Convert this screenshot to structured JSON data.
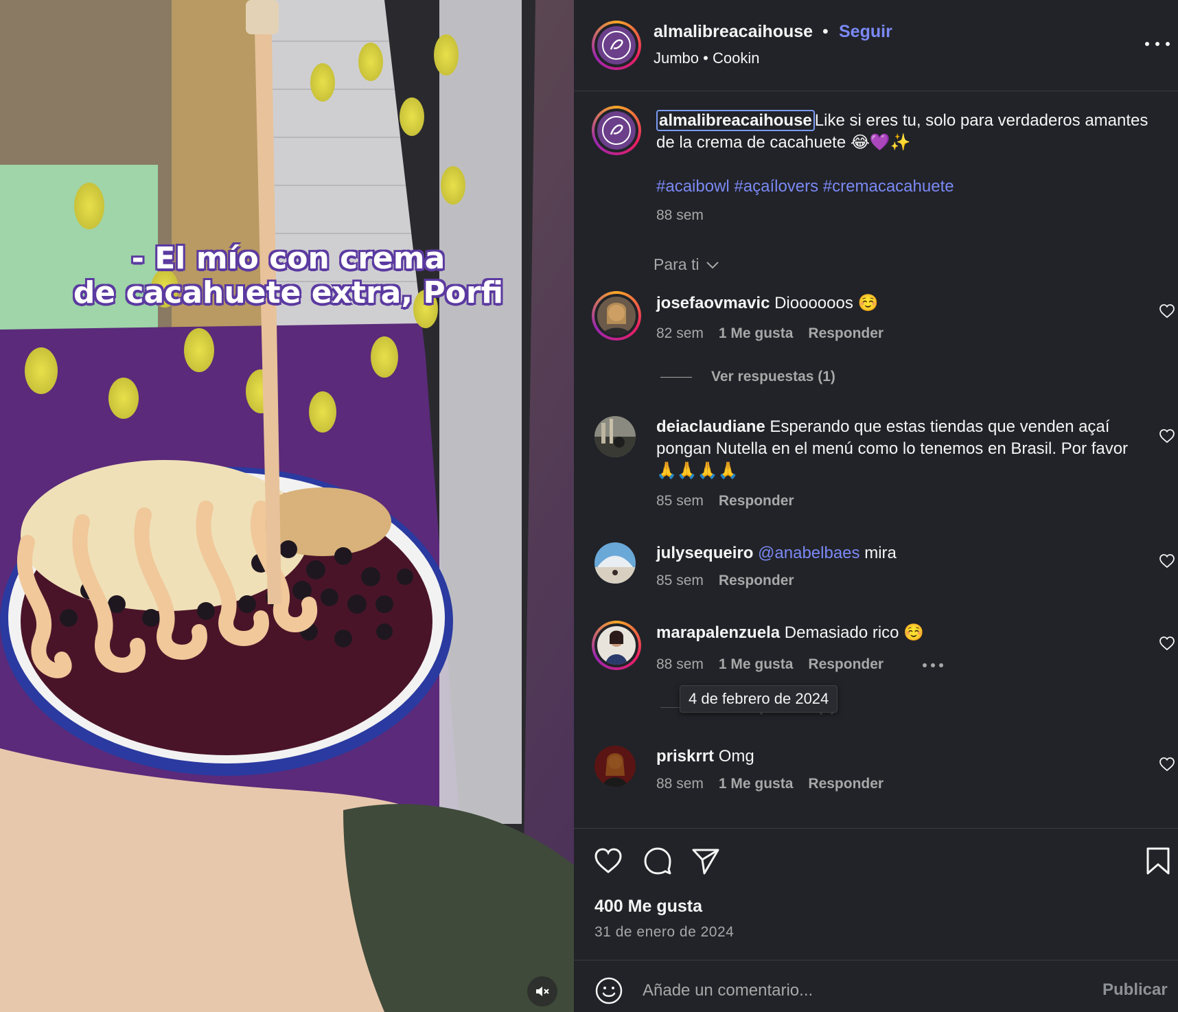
{
  "media": {
    "overlay_line1": "- El mío con crema",
    "overlay_line2": "de cacahuete extra, Porfi",
    "mute_icon": "speaker-muted-icon"
  },
  "header": {
    "username": "almalibreacaihouse",
    "separator": "•",
    "follow_label": "Seguir",
    "subtitle": "Jumbo • Cookin",
    "more_icon": "more-horizontal-icon"
  },
  "caption": {
    "username": "almalibreacaihouse",
    "text": "Like si eres tu, solo para verdaderos amantes de la crema de cacahuete 😂💜✨",
    "hashtags": "#acaibowl #açaílovers #cremacacahuete",
    "time": "88 sem"
  },
  "sort": {
    "label": "Para ti"
  },
  "comments": [
    {
      "user": "josefaovmavic",
      "text": "Dioooooos ☺️",
      "time": "82 sem",
      "likes": "1 Me gusta",
      "reply": "Responder",
      "replies": "Ver respuestas (1)"
    },
    {
      "user": "deiaclaudiane",
      "text": "Esperando que estas tiendas que venden açaí pongan Nutella en el menú como lo tenemos en Brasil. Por favor 🙏🙏🙏🙏",
      "time": "85 sem",
      "reply": "Responder"
    },
    {
      "user": "julysequeiro",
      "mention": "@anabelbaes",
      "text": "mira",
      "time": "85 sem",
      "reply": "Responder"
    },
    {
      "user": "marapalenzuela",
      "text": "Demasiado rico ☺️",
      "time": "88 sem",
      "likes": "1 Me gusta",
      "reply": "Responder",
      "replies": "Ver respuestas (1)",
      "tooltip": "4 de febrero de 2024"
    },
    {
      "user": "priskrrt",
      "text": "Omg",
      "time": "88 sem",
      "likes": "1 Me gusta",
      "reply": "Responder"
    }
  ],
  "footer": {
    "likes": "400 Me gusta",
    "date": "31 de enero de 2024",
    "comment_placeholder": "Añade un comentario...",
    "publish_label": "Publicar"
  },
  "colors": {
    "panel_bg": "#212328",
    "link": "#7b89f5",
    "muted": "#a8a8a8"
  }
}
